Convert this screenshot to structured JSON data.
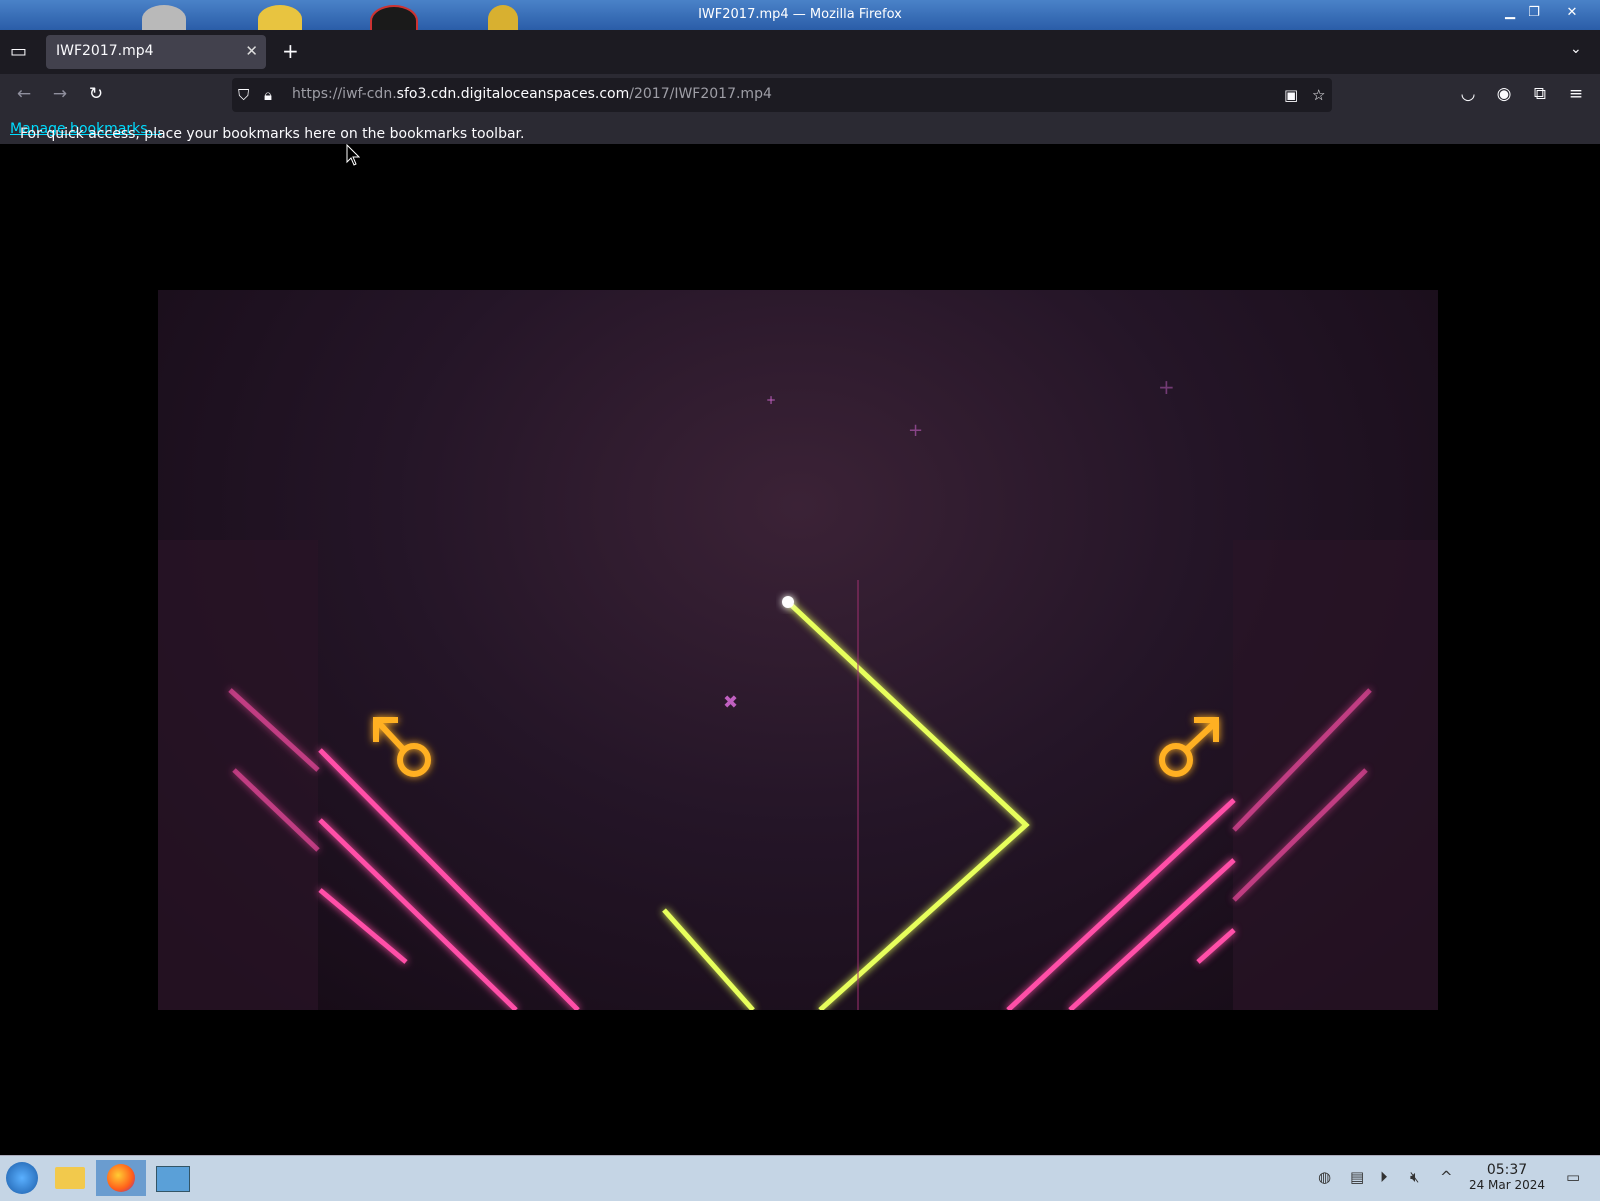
{
  "window": {
    "title": "IWF2017.mp4 — Mozilla Firefox"
  },
  "tabs": [
    {
      "label": "IWF2017.mp4",
      "active": true
    }
  ],
  "navbar": {
    "url_prefix": "https://iwf-cdn.",
    "url_domain": "sfo3.cdn.digitaloceanspaces.com",
    "url_path": "/2017/IWF2017.mp4"
  },
  "bookmarks_bar": {
    "message": "For quick access, place your bookmarks here on the bookmarks toolbar.",
    "link": "Manage bookmarks…"
  },
  "taskbar": {
    "time": "05:37",
    "date": "24 Mar 2024"
  },
  "colors": {
    "tab_strip": "#1c1b22",
    "toolbar": "#2b2a33",
    "link": "#00ddff",
    "taskbar": "#c5d5e5",
    "neon_pink": "#ff4fa8",
    "neon_yellow": "#e7ff5c",
    "neon_orange": "#ffb020"
  }
}
